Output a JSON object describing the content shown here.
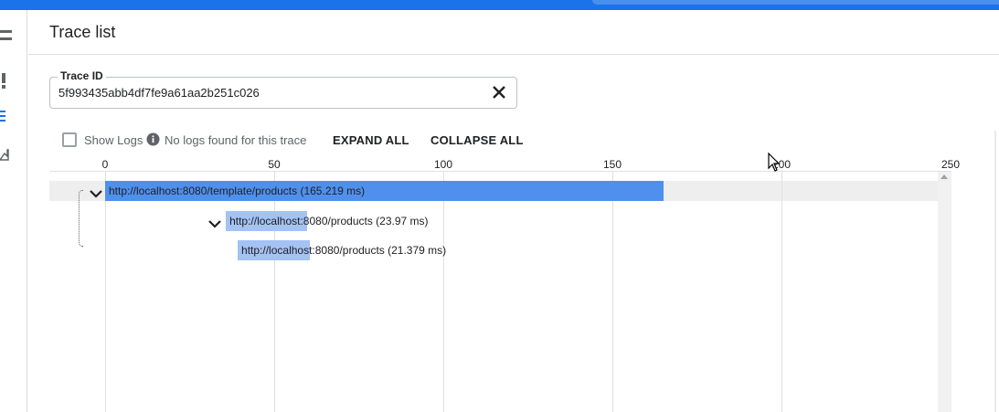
{
  "header": {
    "title": "Trace list"
  },
  "trace_id": {
    "label": "Trace ID",
    "value": "5f993435abb4df7fe9a61aa2b251c026",
    "placeholder": ""
  },
  "controls": {
    "show_logs_label": "Show Logs",
    "show_logs_checked": false,
    "no_logs_text": "No logs found for this trace",
    "expand_all": "EXPAND ALL",
    "collapse_all": "COLLAPSE ALL"
  },
  "colors": {
    "accent": "#1a73e8",
    "root_span": "#4f90ec",
    "child_span": "#a4c2f4",
    "row_highlight": "#eeeeee"
  },
  "rail_icons": [
    "menu-icon",
    "alert-icon",
    "list-icon",
    "analytics-icon"
  ],
  "chart_data": {
    "type": "gantt",
    "x_ticks": [
      "0",
      "50",
      "100",
      "150",
      "200",
      "250"
    ],
    "x_range": [
      0,
      250
    ],
    "unit": "ms",
    "spans": [
      {
        "label": "http://localhost:8080/template/products (165.219 ms)",
        "start": 0,
        "duration": 165.219,
        "depth": 0,
        "expanded": true
      },
      {
        "label": "http://localhost:8080/products (23.97 ms)",
        "start": 35.7,
        "duration": 23.97,
        "depth": 1,
        "expanded": true
      },
      {
        "label": "http://localhost:8080/products (21.379 ms)",
        "start": 39.2,
        "duration": 21.379,
        "depth": 2,
        "expanded": false
      }
    ]
  }
}
